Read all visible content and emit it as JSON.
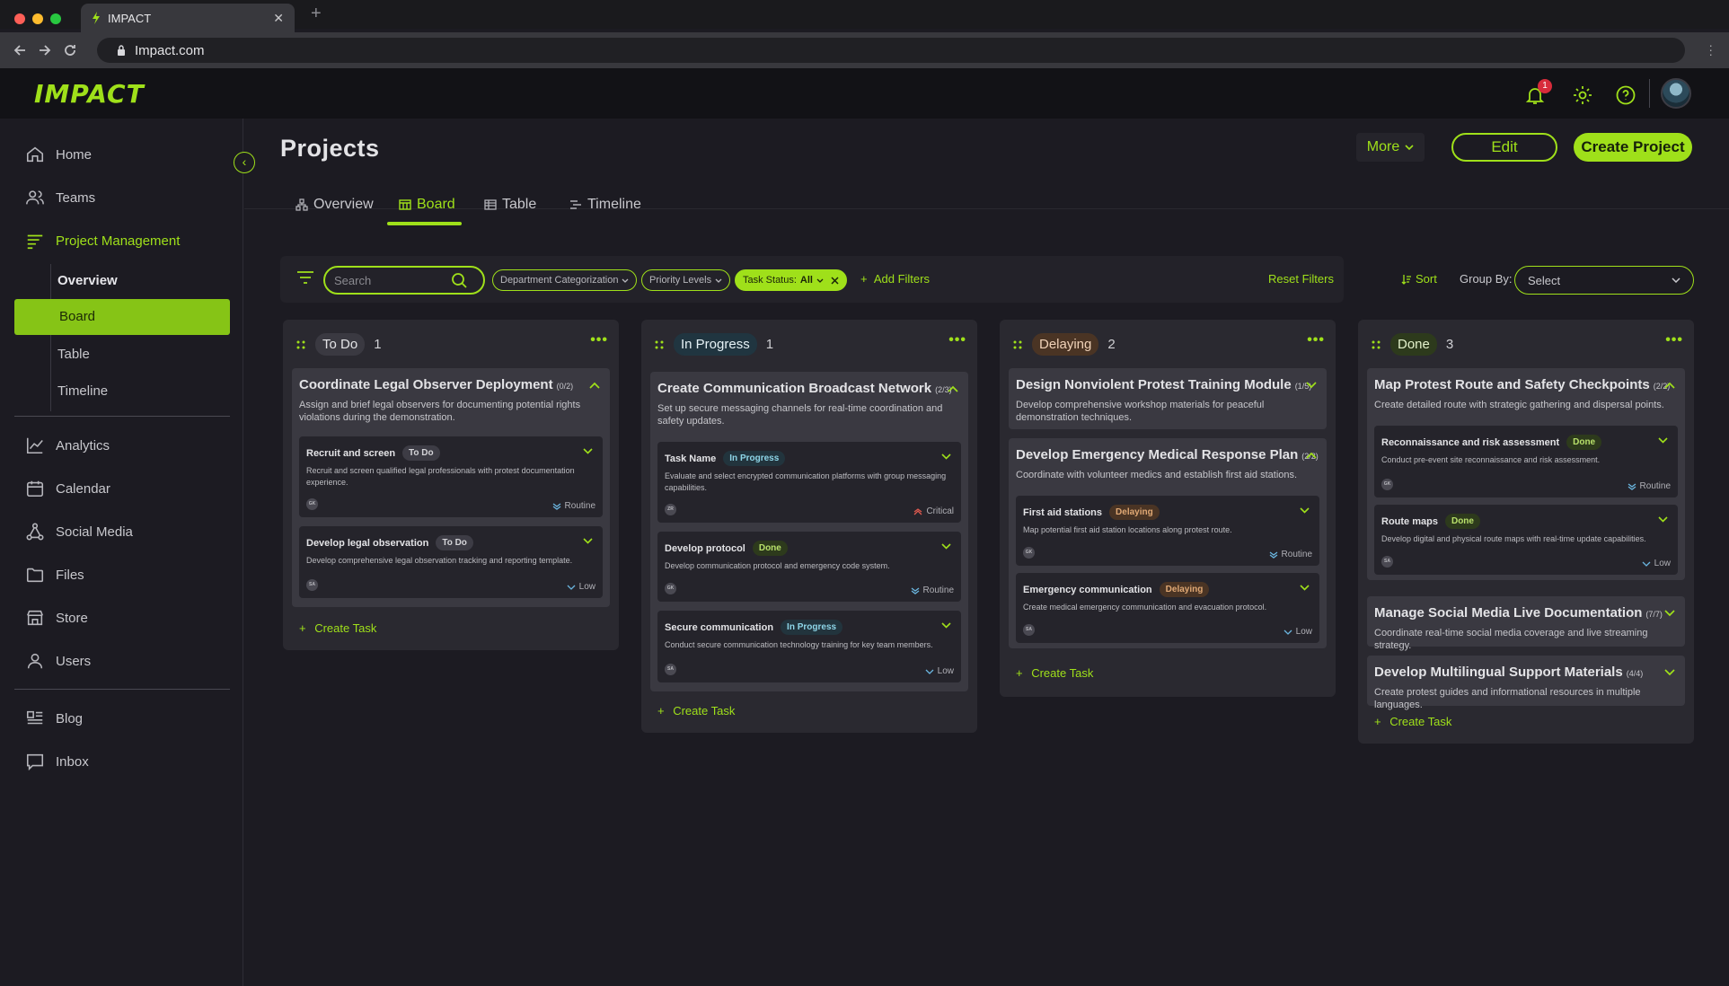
{
  "browser": {
    "tab_title": "IMPACT",
    "url": "Impact.com",
    "new_tab": "+",
    "close": "✕"
  },
  "header": {
    "logo": "IMPACT",
    "notification_count": "1"
  },
  "sidebar": {
    "items": [
      {
        "label": "Home",
        "icon": "home-icon"
      },
      {
        "label": "Teams",
        "icon": "users-icon"
      },
      {
        "label": "Project Management",
        "icon": "list-icon"
      },
      {
        "label": "Analytics",
        "icon": "chart-line-icon"
      },
      {
        "label": "Calendar",
        "icon": "calendar-icon"
      },
      {
        "label": "Social Media",
        "icon": "share-icon"
      },
      {
        "label": "Files",
        "icon": "folder-icon"
      },
      {
        "label": "Store",
        "icon": "store-icon"
      },
      {
        "label": "Users",
        "icon": "user-icon"
      },
      {
        "label": "Blog",
        "icon": "blog-icon"
      },
      {
        "label": "Inbox",
        "icon": "inbox-icon"
      }
    ],
    "sub_items": [
      "Overview",
      "Board",
      "Table",
      "Timeline"
    ]
  },
  "page": {
    "title": "Projects",
    "more_label": "More",
    "edit_label": "Edit",
    "create_label": "Create Project",
    "tabs": [
      "Overview",
      "Board",
      "Table",
      "Timeline"
    ]
  },
  "filters": {
    "search_placeholder": "Search",
    "department": "Department Categorization",
    "priority": "Priority Levels",
    "status_prefix": "Task Status:",
    "status_value": "All",
    "add_filters": "Add Filters",
    "reset": "Reset Filters",
    "sort": "Sort",
    "group_by_label": "Group By:",
    "group_by_value": "Select"
  },
  "columns": [
    {
      "title": "To Do",
      "count": "1",
      "create_task": "Create Task",
      "projects": [
        {
          "title": "Coordinate Legal Observer Deployment",
          "frac": "(0/2)",
          "desc": "Assign and brief legal observers for documenting potential rights violations during the demonstration.",
          "tasks": [
            {
              "name": "Recruit and screen",
              "status": "To Do",
              "desc": "Recruit and screen qualified legal professionals with protest documentation experience.",
              "assignee": "GK",
              "priority": "Routine"
            },
            {
              "name": "Develop legal observation",
              "status": "To Do",
              "desc": "Develop comprehensive legal observation tracking and reporting template.",
              "assignee": "SA",
              "priority": "Low"
            }
          ]
        }
      ]
    },
    {
      "title": "In Progress",
      "count": "1",
      "create_task": "Create Task",
      "projects": [
        {
          "title": "Create Communication Broadcast Network",
          "frac": "(2/3)",
          "desc": "Set up secure messaging channels for real-time coordination and safety updates.",
          "tasks": [
            {
              "name": "Task Name",
              "status": "In Progress",
              "desc": "Evaluate and select encrypted communication platforms with group messaging capabilities.",
              "assignee": "ZR",
              "priority": "Critical"
            },
            {
              "name": "Develop protocol",
              "status": "Done",
              "desc": "Develop communication protocol and emergency code system.",
              "assignee": "GK",
              "priority": "Routine"
            },
            {
              "name": "Secure communication",
              "status": "In Progress",
              "desc": "Conduct secure communication technology training for key team members.",
              "assignee": "SA",
              "priority": "Low"
            }
          ]
        }
      ]
    },
    {
      "title": "Delaying",
      "count": "2",
      "create_task": "Create Task",
      "projects": [
        {
          "title": "Design Nonviolent Protest Training Module",
          "frac": "(1/5)",
          "desc": "Develop comprehensive workshop materials for peaceful demonstration techniques.",
          "tasks": []
        },
        {
          "title": "Develop Emergency Medical Response Plan",
          "frac": "(2/2)",
          "desc": "Coordinate with volunteer medics and establish first aid stations.",
          "tasks": [
            {
              "name": "First aid stations",
              "status": "Delaying",
              "desc": "Map potential first aid station locations along protest route.",
              "assignee": "GK",
              "priority": "Routine"
            },
            {
              "name": "Emergency communication",
              "status": "Delaying",
              "desc": "Create medical emergency communication and evacuation protocol.",
              "assignee": "SA",
              "priority": "Low"
            }
          ]
        }
      ]
    },
    {
      "title": "Done",
      "count": "3",
      "create_task": "Create Task",
      "projects": [
        {
          "title": "Map Protest Route and Safety Checkpoints",
          "frac": "(2/2)",
          "desc": "Create detailed route with strategic gathering and dispersal points.",
          "tasks": [
            {
              "name": "Reconnaissance and risk assessment",
              "status": "Done",
              "desc": "Conduct pre-event site reconnaissance and risk assessment.",
              "assignee": "GK",
              "priority": "Routine"
            },
            {
              "name": "Route maps",
              "status": "Done",
              "desc": "Develop digital and physical route maps with real-time update capabilities.",
              "assignee": "SA",
              "priority": "Low"
            }
          ]
        },
        {
          "title": "Manage Social Media Live Documentation",
          "frac": "(7/7)",
          "desc": "Coordinate real-time social media coverage and live streaming strategy.",
          "tasks": []
        },
        {
          "title": "Develop Multilingual Support Materials",
          "frac": "(4/4)",
          "desc": "Create protest guides and informational resources in multiple languages.",
          "tasks": []
        }
      ]
    }
  ],
  "colors": {
    "accent": "#9fe01a",
    "background": "#1c1b22",
    "critical": "#e05a4f"
  }
}
